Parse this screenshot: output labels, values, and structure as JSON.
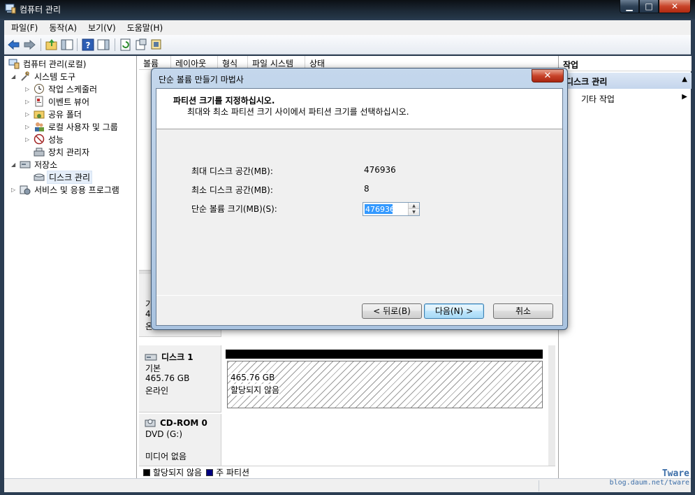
{
  "window": {
    "title": "컴퓨터 관리",
    "min_glyph": "▁",
    "max_glyph": "□",
    "close_glyph": "✕"
  },
  "menu": [
    "파일(F)",
    "동작(A)",
    "보기(V)",
    "도움말(H)"
  ],
  "tree": {
    "root": "컴퓨터 관리(로컬)",
    "system_tools": "시스템 도구",
    "task_scheduler": "작업 스케줄러",
    "event_viewer": "이벤트 뷰어",
    "shared_folders": "공유 폴더",
    "local_users": "로컬 사용자 및 그룹",
    "performance": "성능",
    "device_manager": "장치 관리자",
    "storage": "저장소",
    "disk_management": "디스크 관리",
    "services": "서비스 및 응용 프로그램"
  },
  "columns": [
    "볼륨",
    "레이아웃",
    "형식",
    "파일 시스템",
    "상태"
  ],
  "disks": {
    "disk1": {
      "name": "디스크 1",
      "type": "기본",
      "size": "465.76 GB",
      "status": "온라인",
      "partition_size": "465.76 GB",
      "partition_label": "할당되지 않음"
    },
    "cdrom": {
      "name": "CD-ROM 0",
      "drive": "DVD (G:)",
      "media": "미디어 없음"
    },
    "partial_lines": [
      "기",
      "4",
      "온"
    ]
  },
  "legend": {
    "unallocated": "할당되지 않음",
    "primary": "주 파티션",
    "unallocated_color": "#000000",
    "primary_color": "#000080"
  },
  "actions": {
    "header": "작업",
    "section": "디스크 관리",
    "more": "기타 작업"
  },
  "dialog": {
    "title": "단순 볼륨 만들기 마법사",
    "heading": "파티션 크기를 지정하십시오.",
    "subheading": "최대와 최소 파티션 크기 사이에서 파티션 크기를 선택하십시오.",
    "max_label": "최대 디스크 공간(MB):",
    "max_value": "476936",
    "min_label": "최소 디스크 공간(MB):",
    "min_value": "8",
    "size_label": "단순 볼륨 크기(MB)(S):",
    "size_value": "476936",
    "back": "< 뒤로(B)",
    "next": "다음(N) >",
    "cancel": "취소"
  },
  "watermark": {
    "line1": "Tware",
    "line2": "blog.daum.net/tware"
  }
}
